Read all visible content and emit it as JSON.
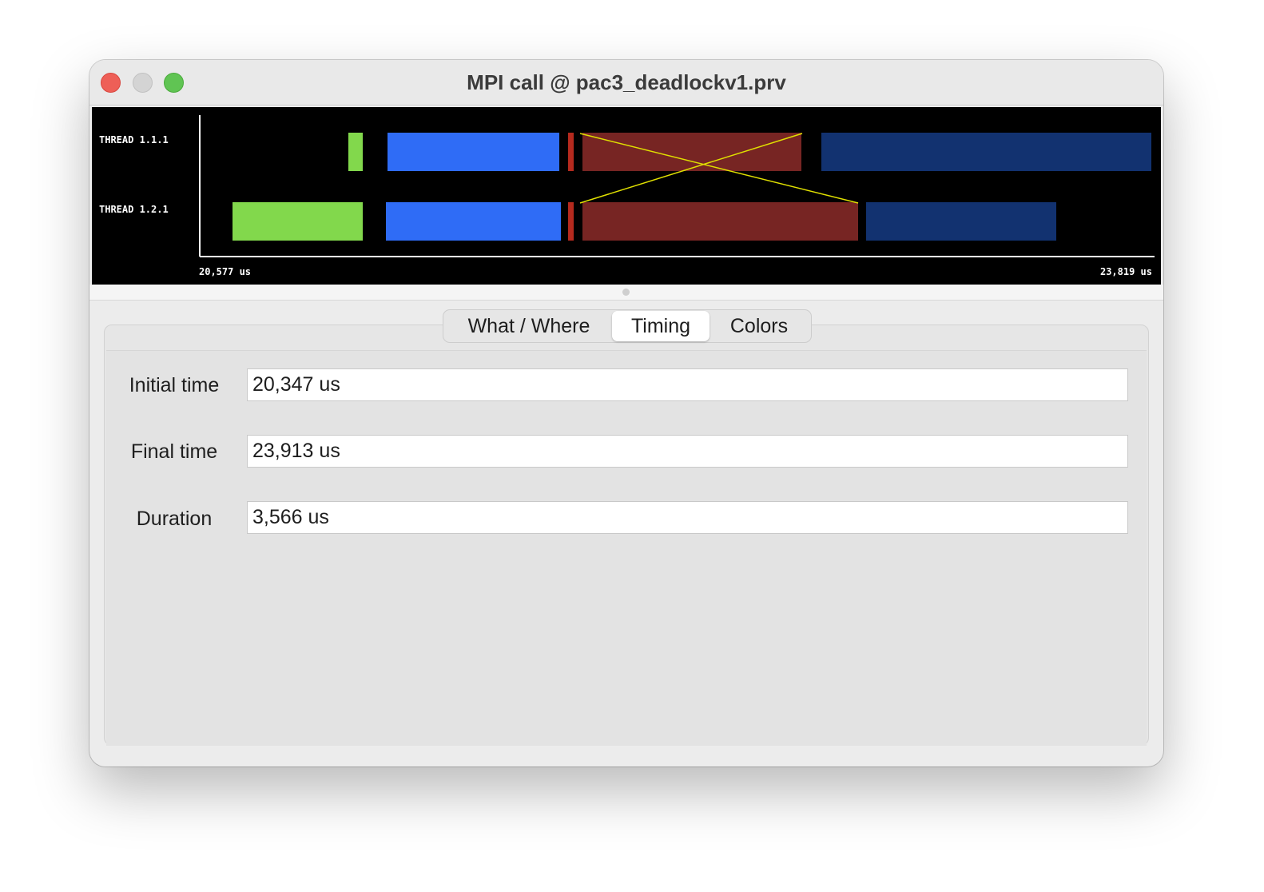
{
  "window": {
    "title": "MPI call @ pac3_deadlockv1.prv"
  },
  "timeline": {
    "threads": [
      "THREAD 1.1.1",
      "THREAD 1.2.1"
    ],
    "start_label": "20,577 us",
    "end_label": "23,819 us",
    "colors": {
      "green": "#82d84c",
      "blue": "#2f6cf6",
      "red": "#b52a1e",
      "dark_red": "#772523",
      "navy": "#123270",
      "comm_line": "#e0e000",
      "axis": "#ffffff"
    }
  },
  "tabs": [
    {
      "label": "What / Where",
      "selected": false
    },
    {
      "label": "Timing",
      "selected": true
    },
    {
      "label": "Colors",
      "selected": false
    }
  ],
  "timing": {
    "initial_label": "Initial time",
    "initial_value": "20,347 us",
    "final_label": "Final time",
    "final_value": "23,913 us",
    "duration_label": "Duration",
    "duration_value": "3,566 us"
  }
}
